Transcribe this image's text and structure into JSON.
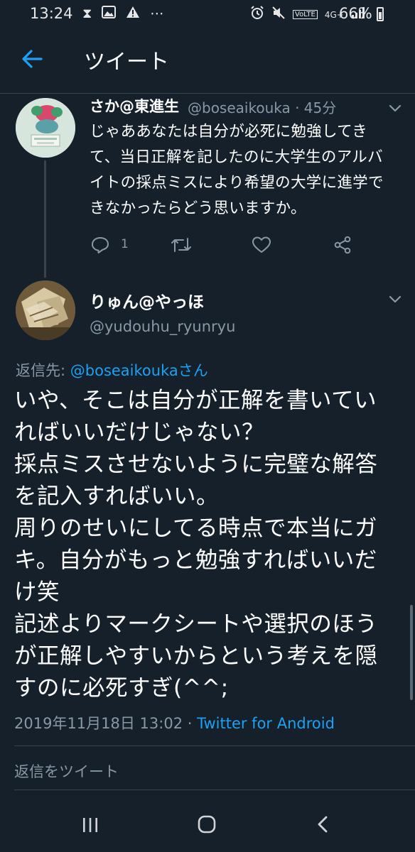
{
  "status": {
    "time": "13:24",
    "network": "4G+",
    "volte": "VoLTE",
    "battery": "66%",
    "icons": [
      "hourglass-icon",
      "image-icon",
      "alert-icon",
      "more-icon",
      "alarm-icon",
      "mute-icon",
      "signal-icon",
      "battery-icon"
    ]
  },
  "header": {
    "title": "ツイート"
  },
  "tweet1": {
    "name": "さか@東進生",
    "handle_time": "@boseaikouka · 45分",
    "text": "じゃああなたは自分が必死に勉強してきて、当日正解を記したのに大学生のアルバイトの採点ミスにより希望の大学に進学できなかったらどう思いますか。",
    "reply_count": "1"
  },
  "tweet2": {
    "name": "りゅん@やっほ",
    "handle": "@yudouhu_ryunryu",
    "reply_prefix": "返信先: ",
    "reply_to": "@boseaikoukaさん",
    "lines": [
      "いや、そこは自分が正解を書いてい",
      "ればいいだけじゃない？",
      "採点ミスさせないように完璧な解答",
      "を記入すればいい。",
      "周りのせいにしてる時点で本当にガ",
      "キ。自分がもっと勉強すればいいだ",
      "け笑",
      "記述よりマークシートや選択のほう",
      "が正解しやすいからという考えを隠",
      "すのに必死すぎ(^^;"
    ],
    "datetime": "2019年11月18日 13:02",
    "dot": " · ",
    "source": "Twitter for Android"
  },
  "reply_placeholder": "返信をツイート",
  "colors": {
    "background": "#15202b",
    "accent": "#1da1f2",
    "muted": "#8899a6",
    "divider": "#38444d"
  }
}
